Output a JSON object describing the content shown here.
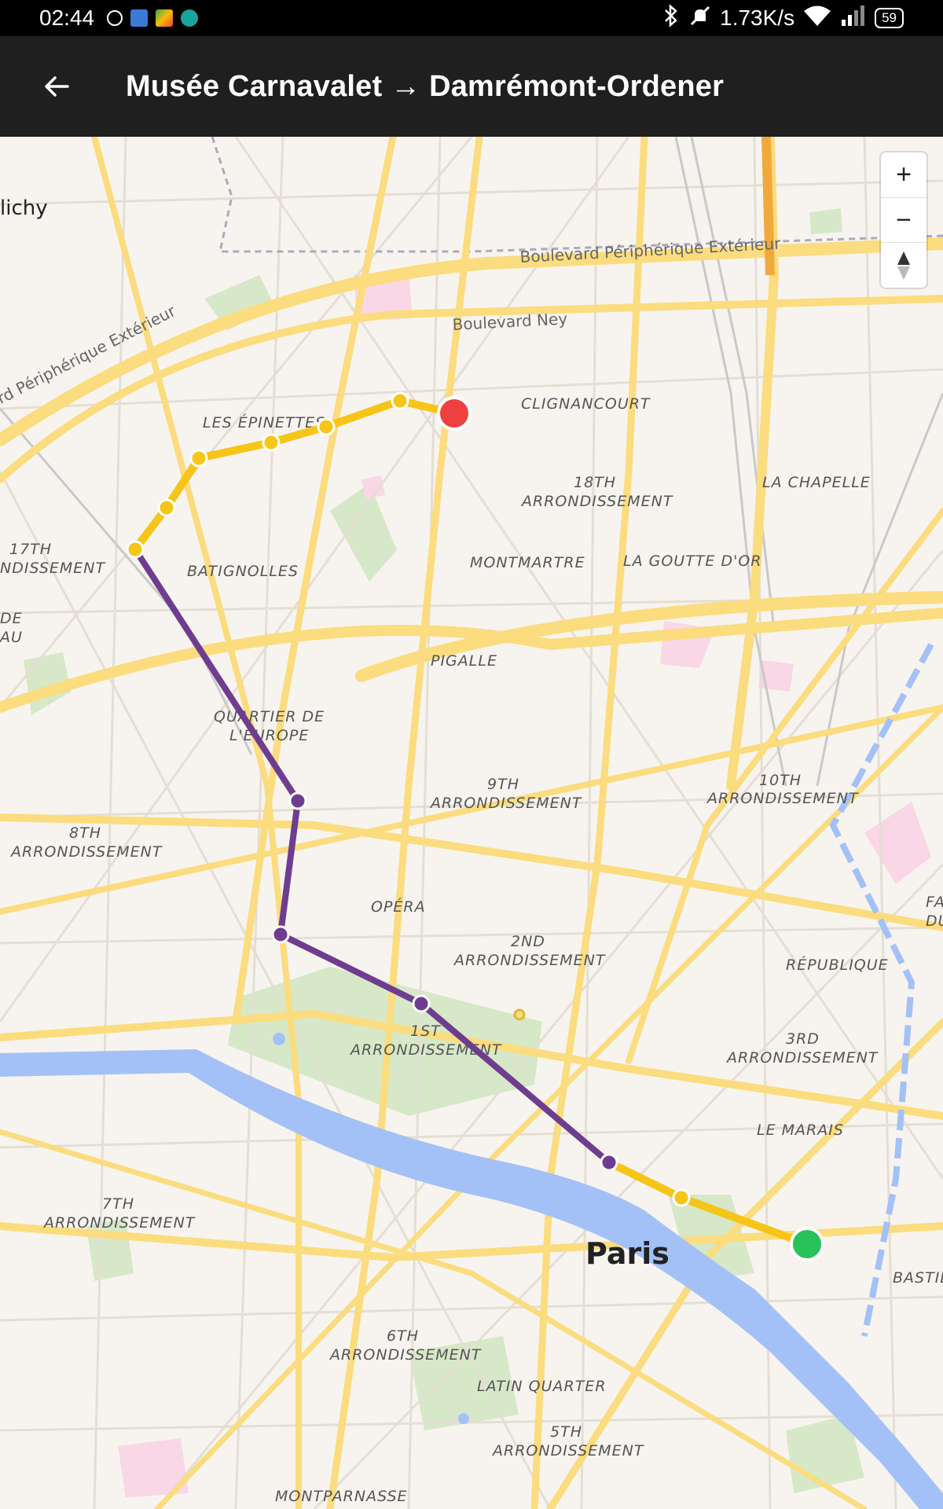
{
  "status_bar": {
    "time": "02:44",
    "net_speed": "1.73K/s",
    "battery": "59"
  },
  "app_bar": {
    "title": "Musée Carnavalet → Damrémont-Ordener"
  },
  "zoom": {
    "in_label": "+",
    "out_label": "−"
  },
  "map_labels": {
    "clichy": "lichy",
    "boulevard_peripherique_top": "Boulevard Périphérique Extérieur",
    "boulevard_peripherique_left": "ard Périphérique Extérieur",
    "boulevard_ney": "Boulevard Ney",
    "clignancourt": "CLIGNANCOURT",
    "les_epinettes": "LES ÉPINETTES",
    "arr18_a": "18TH",
    "arr18_b": "ARRONDISSEMENT",
    "la_chapelle": "LA CHAPELLE",
    "arr17_a": "17TH",
    "arr17_b": "NDISSEMENT",
    "batignolles": "BATIGNOLLES",
    "montmartre": "MONTMARTRE",
    "la_goutte_dor": "LA GOUTTE D'OR",
    "de": "DE",
    "au": "AU",
    "pigalle": "PIGALLE",
    "quartier_a": "QUARTIER DE",
    "quartier_b": "L'EUROPE",
    "arr9_a": "9TH",
    "arr9_b": "ARRONDISSEMENT",
    "arr10_a": "10TH",
    "arr10_b": "ARRONDISSEMENT",
    "arr8_a": "8TH",
    "arr8_b": "ARRONDISSEMENT",
    "opera": "OPÉRA",
    "fa": "FA",
    "du": "DU",
    "arr2_a": "2ND",
    "arr2_b": "ARRONDISSEMENT",
    "republique": "RÉPUBLIQUE",
    "arr1_a": "1ST",
    "arr1_b": "ARRONDISSEMENT",
    "arr3_a": "3RD",
    "arr3_b": "ARRONDISSEMENT",
    "le_marais": "LE MARAIS",
    "arr7_a": "7TH",
    "arr7_b": "ARRONDISSEMENT",
    "paris": "Paris",
    "basti": "BASTIL",
    "arr6_a": "6TH",
    "arr6_b": "ARRONDISSEMENT",
    "latin_quarter": "LATIN QUARTER",
    "arr5_a": "5TH",
    "arr5_b": "ARRONDISSEMENT",
    "montparnasse": "MONTPARNASSE"
  },
  "colors": {
    "route_walk": "#f5c518",
    "route_metro": "#6f3d8f",
    "start_marker": "#28c25a",
    "end_marker": "#ef4040",
    "river": "#a4c1f7",
    "road": "#fbdc7e",
    "park": "#d6e8c8"
  }
}
